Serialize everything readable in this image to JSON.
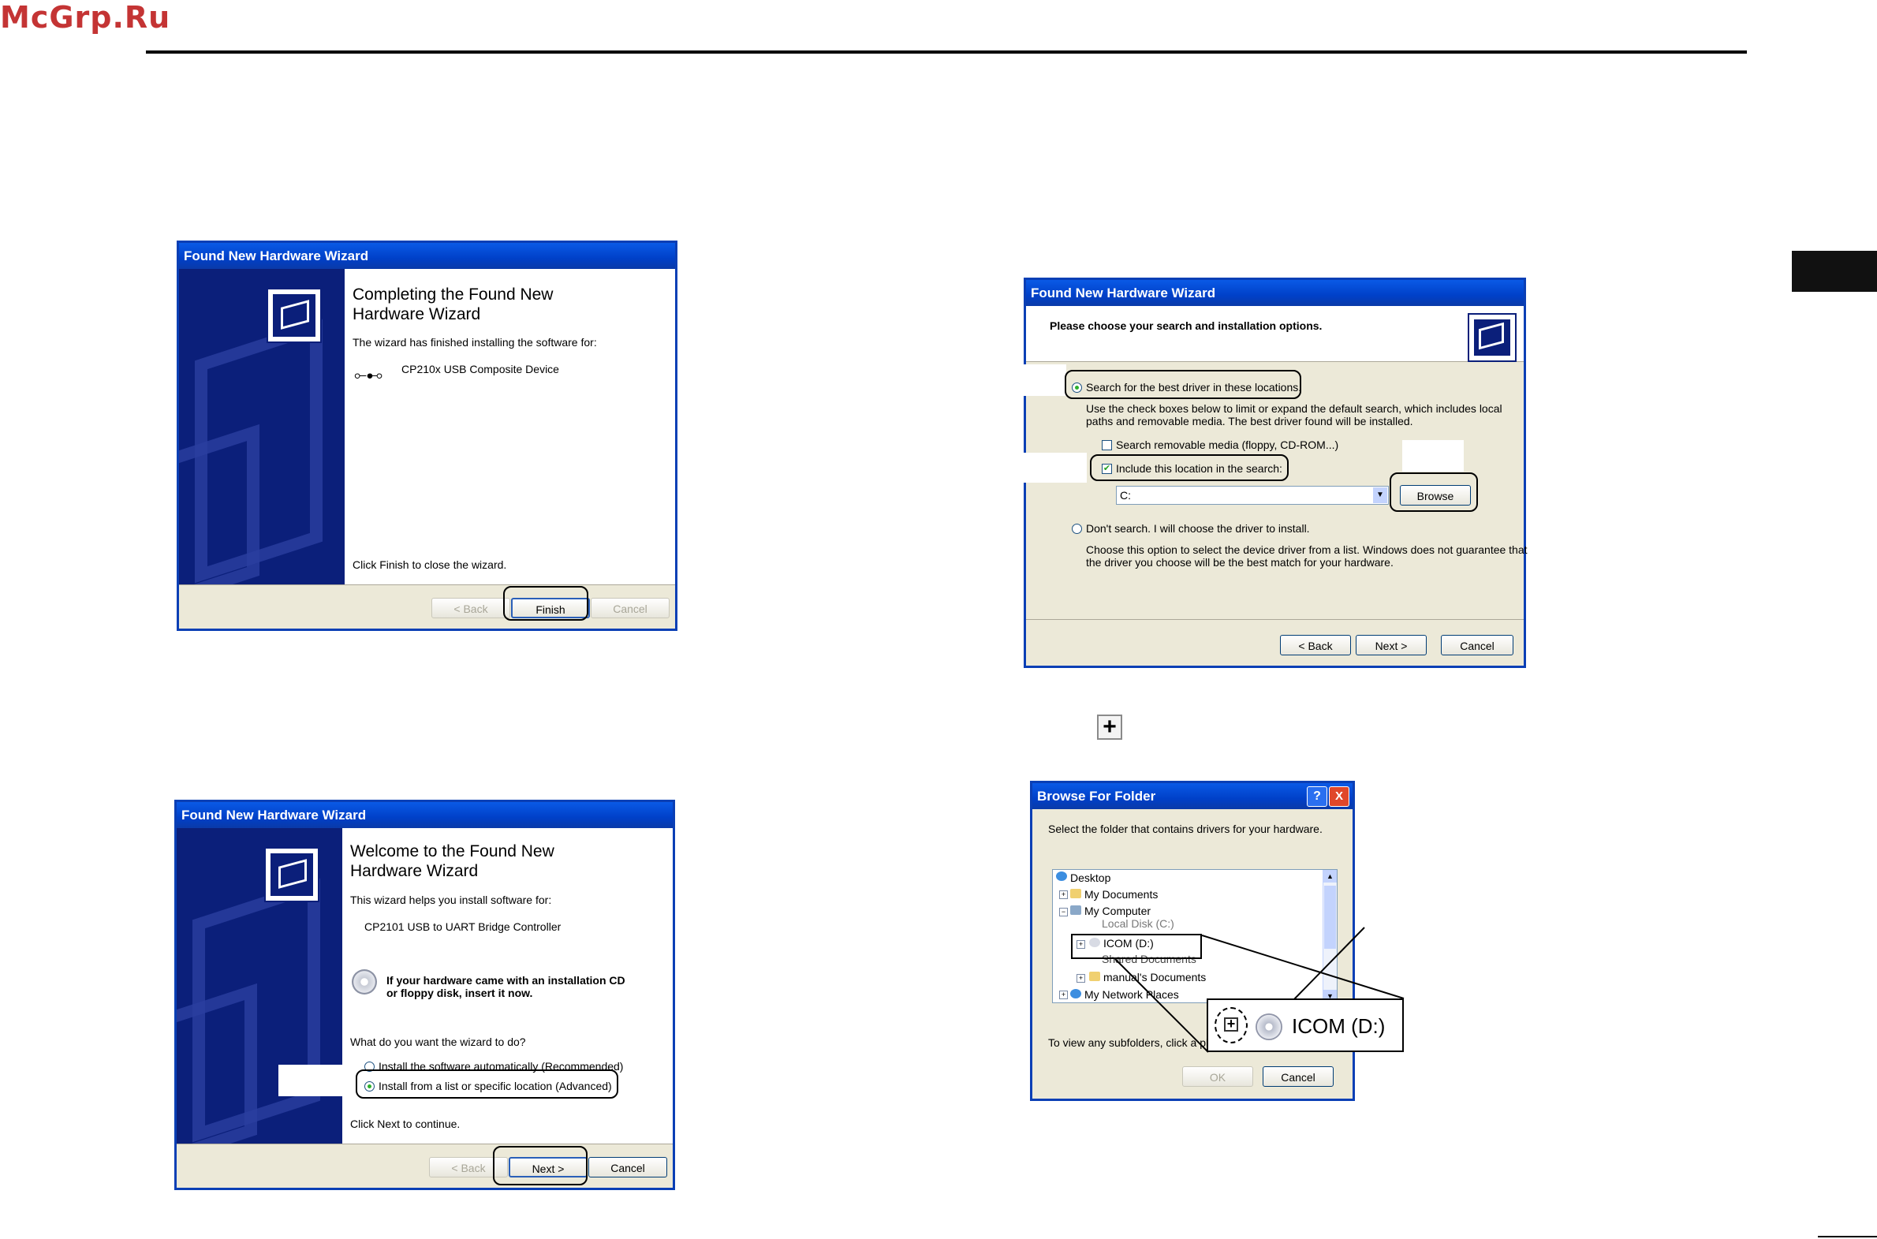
{
  "page": {
    "watermark": "McGrp.Ru"
  },
  "dlg_finish": {
    "title": "Found New Hardware Wizard",
    "heading_line1": "Completing the Found New",
    "heading_line2": "Hardware Wizard",
    "finished_text": "The wizard has finished installing the software for:",
    "device": "CP210x USB Composite Device",
    "close_text": "Click Finish to close the wizard.",
    "back_label": "< Back",
    "finish_label": "Finish",
    "cancel_label": "Cancel"
  },
  "dlg_welcome": {
    "title": "Found New Hardware Wizard",
    "heading_line1": "Welcome to the Found New",
    "heading_line2": "Hardware Wizard",
    "helps_text": "This wizard helps you install software for:",
    "device": "CP2101 USB to UART Bridge Controller",
    "cd_line1": "If your hardware came with an installation CD",
    "cd_line2": "or floppy disk, insert it now.",
    "question": "What do you want the wizard to do?",
    "option_auto": "Install the software automatically (Recommended)",
    "option_list": "Install from a list or specific location (Advanced)",
    "continue_text": "Click Next to continue.",
    "back_label": "< Back",
    "next_label": "Next >",
    "cancel_label": "Cancel"
  },
  "dlg_search": {
    "title": "Found New Hardware Wizard",
    "header": "Please choose your search and installation options.",
    "opt_search": "Search for the best driver in these locations.",
    "search_desc_1": "Use the check boxes below to limit or expand the default search, which includes local",
    "search_desc_2": "paths and removable media. The best driver found will be installed.",
    "chk_removable": "Search removable media (floppy, CD-ROM...)",
    "chk_include": "Include this location in the search:",
    "location_value": "C:",
    "browse_label": "Browse",
    "opt_dont": "Don't search. I will choose the driver to install.",
    "dont_desc_1": "Choose this option to select the device driver from a list.  Windows does not guarantee that",
    "dont_desc_2": "the driver you choose will be the best match for your hardware.",
    "back_label": "< Back",
    "next_label": "Next >",
    "cancel_label": "Cancel"
  },
  "plus_symbol": "+",
  "dlg_browse": {
    "title": "Browse For Folder",
    "help_btn": "?",
    "close_btn": "X",
    "instruction": "Select the folder that contains drivers for your hardware.",
    "tree": {
      "desktop": "Desktop",
      "my_documents": "My Documents",
      "my_computer": "My Computer",
      "local_disk": "Local Disk (C:)",
      "icom": "ICOM (D:)",
      "shared": "Shared Documents",
      "manuals": "manual's Documents",
      "network": "My Network Places"
    },
    "hint": "To view any subfolders, click a plus sign above.",
    "ok_label": "OK",
    "cancel_label": "Cancel",
    "zoom_label": "ICOM (D:)"
  }
}
